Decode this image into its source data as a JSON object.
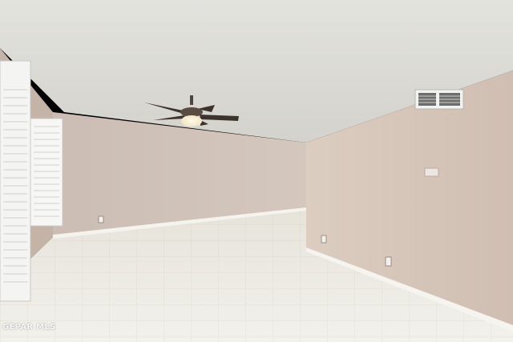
{
  "watermark": "GEPAR MLS",
  "colors": {
    "ceiling": "#dcdcd6",
    "wall_back": "#cdbfb5",
    "wall_right": "#d6c6b9",
    "wall_left": "#c7b6aa",
    "floor": "#ebe9e1",
    "baseboard": "#f6f4ef",
    "shutter": "#f7f7f5",
    "fan_blade": "#4b3a30"
  }
}
